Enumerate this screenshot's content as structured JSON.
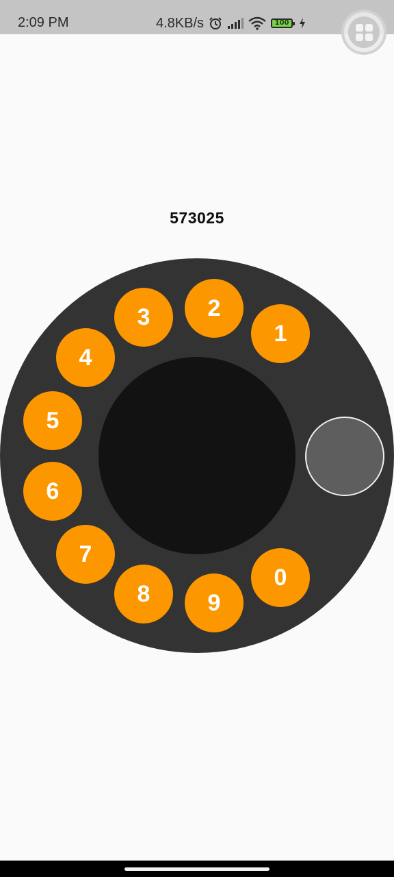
{
  "status_bar": {
    "time": "2:09 PM",
    "net_speed": "4.8KB/s",
    "battery": "100",
    "icons": [
      "alarm-icon",
      "signal-icon",
      "wifi-icon",
      "battery-icon",
      "charging-icon"
    ]
  },
  "dialed_number": "573025",
  "dial": {
    "digits": [
      {
        "label": "1",
        "name": "dial-digit-1"
      },
      {
        "label": "2",
        "name": "dial-digit-2"
      },
      {
        "label": "3",
        "name": "dial-digit-3"
      },
      {
        "label": "4",
        "name": "dial-digit-4"
      },
      {
        "label": "5",
        "name": "dial-digit-5"
      },
      {
        "label": "6",
        "name": "dial-digit-6"
      },
      {
        "label": "7",
        "name": "dial-digit-7"
      },
      {
        "label": "8",
        "name": "dial-digit-8"
      },
      {
        "label": "9",
        "name": "dial-digit-9"
      },
      {
        "label": "0",
        "name": "dial-digit-0"
      }
    ]
  },
  "colors": {
    "digit_bg": "#fd9700",
    "dial_bg": "#333333",
    "dial_center": "#121212",
    "finger_stop": "#5e5e5e",
    "page_bg": "#fafafa"
  }
}
